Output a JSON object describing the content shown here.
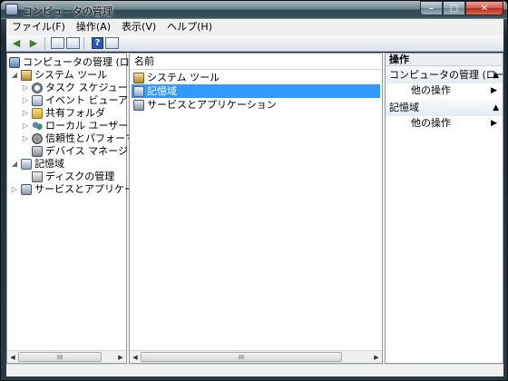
{
  "window": {
    "title": "コンピュータの管理"
  },
  "menubar": [
    {
      "label": "ファイル(F)"
    },
    {
      "label": "操作(A)"
    },
    {
      "label": "表示(V)"
    },
    {
      "label": "ヘルプ(H)"
    }
  ],
  "tree": {
    "root": "コンピュータの管理 (ローカル",
    "system_tools": "システム ツール",
    "task_scheduler": "タスク スケジューラ",
    "event_viewer": "イベント ビューア",
    "shared_folders": "共有フォルダ",
    "local_users": "ローカル ユーザーとグ",
    "reliability": "信頼性とパフォーマンス",
    "device_manager": "デバイス マネージャ",
    "storage": "記憶域",
    "disk_management": "ディスクの管理",
    "services_apps": "サービスとアプリケーショ"
  },
  "center": {
    "column_header": "名前",
    "rows": [
      {
        "label": "システム ツール"
      },
      {
        "label": "記憶域"
      },
      {
        "label": "サービスとアプリケーション"
      }
    ]
  },
  "actions": {
    "header": "操作",
    "section1": "コンピュータの管理 (ロー...",
    "section1_item": "他の操作",
    "section2": "記憶域",
    "section2_item": "他の操作"
  },
  "scroll_thumb_label": "III"
}
